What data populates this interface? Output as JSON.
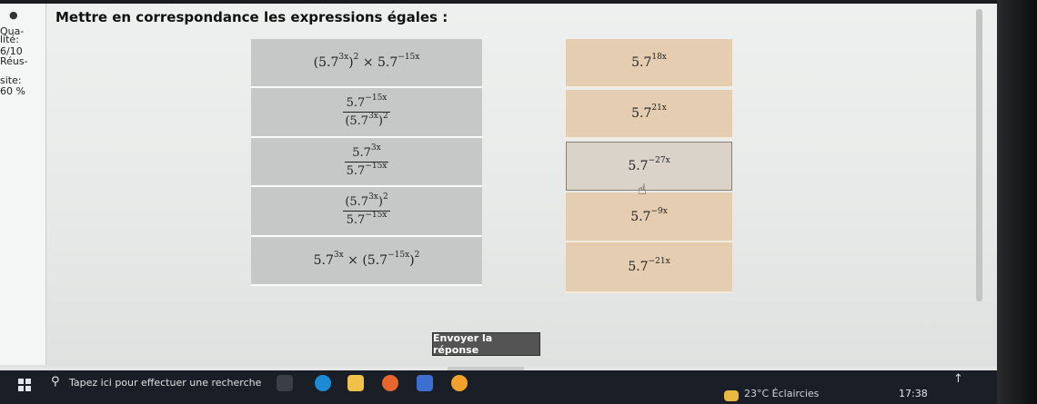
{
  "sidebar": {
    "stats": [
      "Qua-",
      "lité:",
      "6/10",
      "Réus-",
      "site:",
      "60 %"
    ]
  },
  "question": {
    "title": "Mettre en correspondance les expressions égales :"
  },
  "left_items": [
    {
      "kind": "expr",
      "parts": [
        "(5.7",
        "3x",
        ")",
        "2",
        " × 5.7",
        "−15x",
        "",
        ""
      ]
    },
    {
      "kind": "frac",
      "num": [
        "5.7",
        "−15x",
        "",
        ""
      ],
      "den": [
        "(5.7",
        "3x",
        ")",
        "2"
      ]
    },
    {
      "kind": "frac",
      "num": [
        "5.7",
        "3x",
        "",
        ""
      ],
      "den": [
        "5.7",
        "−15x",
        "",
        ""
      ]
    },
    {
      "kind": "frac",
      "num": [
        "(5.7",
        "3x",
        ")",
        "2"
      ],
      "den": [
        "5.7",
        "−15x",
        "",
        ""
      ]
    },
    {
      "kind": "expr",
      "parts": [
        "5.7",
        "3x",
        " × (5.7",
        "−15x",
        ")",
        "2",
        "",
        ""
      ]
    }
  ],
  "right_items": [
    {
      "base": "5.7",
      "exp": "18x"
    },
    {
      "base": "5.7",
      "exp": "21x"
    },
    {
      "base": "5.7",
      "exp": "−27x"
    },
    {
      "base": "5.7",
      "exp": "−9x"
    },
    {
      "base": "5.7",
      "exp": "−21x"
    }
  ],
  "selected_right_index": 2,
  "submit": {
    "label": "Envoyer la réponse"
  },
  "taskbar": {
    "search_placeholder": "Tapez ici pour effectuer une recherche",
    "weather": "23°C  Éclaircies",
    "clock": "17:38"
  },
  "colors": {
    "left_cell": "#c6c7c7",
    "right_cell": "#e4cdb0",
    "button": "#545454"
  }
}
